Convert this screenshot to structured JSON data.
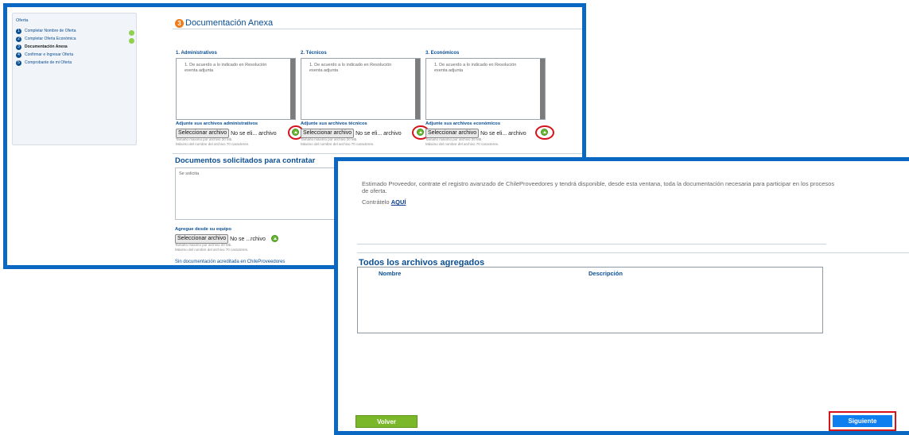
{
  "sidebar": {
    "title": "Oferta",
    "steps": [
      {
        "num": "1",
        "label": "Completar Nombre de Oferta"
      },
      {
        "num": "2",
        "label": "Completar Oferta Económica"
      },
      {
        "num": "3",
        "label": "Documentación Anexa"
      },
      {
        "num": "4",
        "label": "Confirmar e Ingresar Oferta"
      },
      {
        "num": "5",
        "label": "Comprobante de mi Oferta"
      }
    ]
  },
  "main": {
    "step_num": "3",
    "title": "Documentación Anexa",
    "columns": [
      {
        "label": "1. Administrativos",
        "text": "1. De acuerdo a lo indicado en Resolución exenta adjunta",
        "adjunte": "Adjunte sus archivos administrativos"
      },
      {
        "label": "2. Técnicos",
        "text": "1. De acuerdo a lo indicado en Resolución exenta adjunta",
        "adjunte": "Adjunte sus archivos técnicos"
      },
      {
        "label": "3. Económicos",
        "text": "1. De acuerdo a lo indicado en Resolución exenta adjunta",
        "adjunte": "Adjunte sus archivos económicos"
      }
    ],
    "file_button": "Seleccionar archivo",
    "file_status": "No se eli... archivo",
    "hint_line1": "Tamaño máximo por archivo 20 Mb.",
    "hint_line2": "Máximo del nombre del archivo 70 caracteres.",
    "docs_title": "Documentos solicitados para contratar",
    "docs_se_solicita": "Se solicita",
    "docs_partial": "N",
    "agregue_label": "Agregue desde su equipo",
    "agregue_status": "No se ...rchivo",
    "sin_doc": "Sin documentación acreditada en ChileProveedores"
  },
  "panel2": {
    "info_text": "Estimado Proveedor, contrate el registro avanzado de ChileProveedores y tendrá disponible, desde esta ventana, toda la documentación necesaria para participar en los procesos de oferta.",
    "contratelo": "Contrátelo",
    "aqui": "AQUÍ",
    "files_title": "Todos los archivos agregados",
    "col_nombre": "Nombre",
    "col_descripcion": "Descripción",
    "btn_volver": "Volver",
    "btn_siguiente": "Siguiente"
  }
}
